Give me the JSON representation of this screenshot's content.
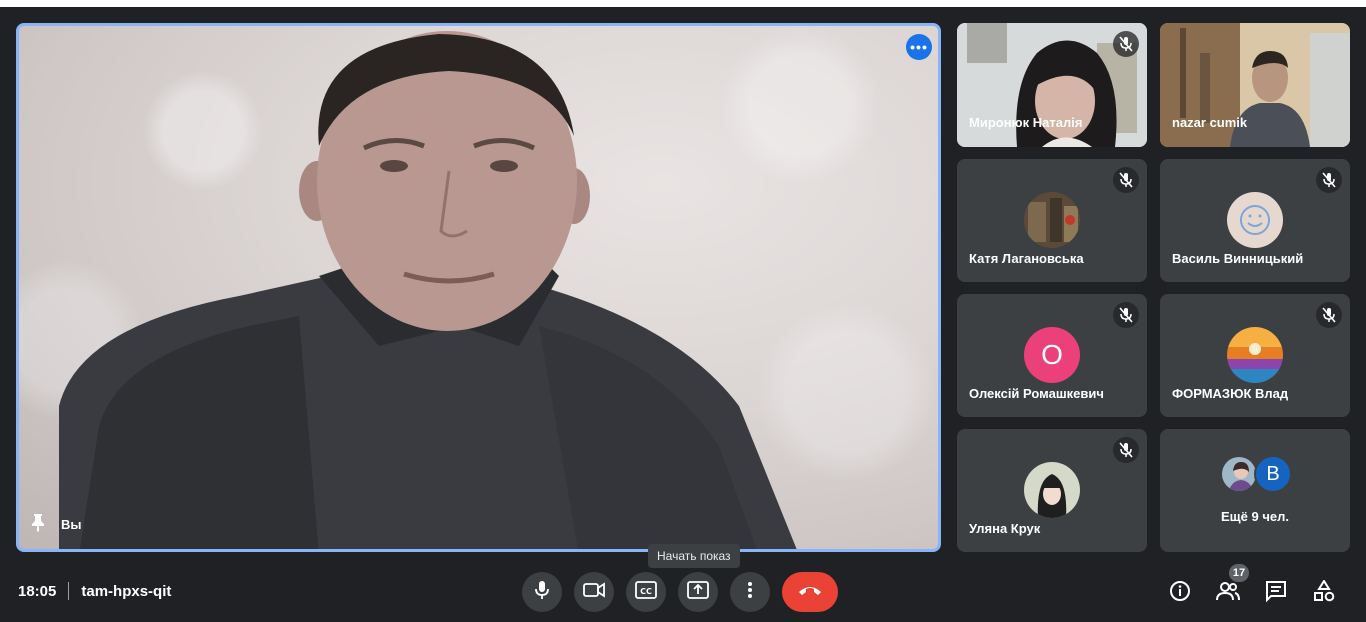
{
  "meeting": {
    "time": "18:05",
    "code": "tam-hpxs-qit"
  },
  "main": {
    "name": "Вы",
    "more_icon": "more-horizontal-icon",
    "pin_icon": "pin-icon"
  },
  "tiles": [
    {
      "name": "Миронюк Наталія",
      "muted": true,
      "type": "video"
    },
    {
      "name": "nazar cumik",
      "muted": false,
      "type": "video"
    },
    {
      "name": "Катя Лагановська",
      "muted": true,
      "type": "photo"
    },
    {
      "name": "Василь Винницький",
      "muted": true,
      "type": "photo"
    },
    {
      "name": "Олексій Ромашкевич",
      "muted": true,
      "type": "letter",
      "letter": "О",
      "color": "#ec407a"
    },
    {
      "name": "ФОРМАЗЮК Влад",
      "muted": true,
      "type": "photo"
    },
    {
      "name": "Уляна Крук",
      "muted": true,
      "type": "photo"
    }
  ],
  "more_tile": {
    "label": "Ещё 9 чел.",
    "letter": "В",
    "letter_color": "#1565c0"
  },
  "controls": {
    "tooltip": "Начать показ",
    "buttons": [
      "mic-icon",
      "camera-icon",
      "captions-icon",
      "present-screen-icon",
      "more-vertical-icon",
      "end-call-icon"
    ]
  },
  "right_panel": {
    "participants_count": "17",
    "icons": [
      "info-icon",
      "people-icon",
      "chat-icon",
      "activities-icon"
    ]
  },
  "colors": {
    "background": "#202124",
    "tile": "#3c4043",
    "accent": "#8ab4f8",
    "end_call": "#ea4335"
  }
}
